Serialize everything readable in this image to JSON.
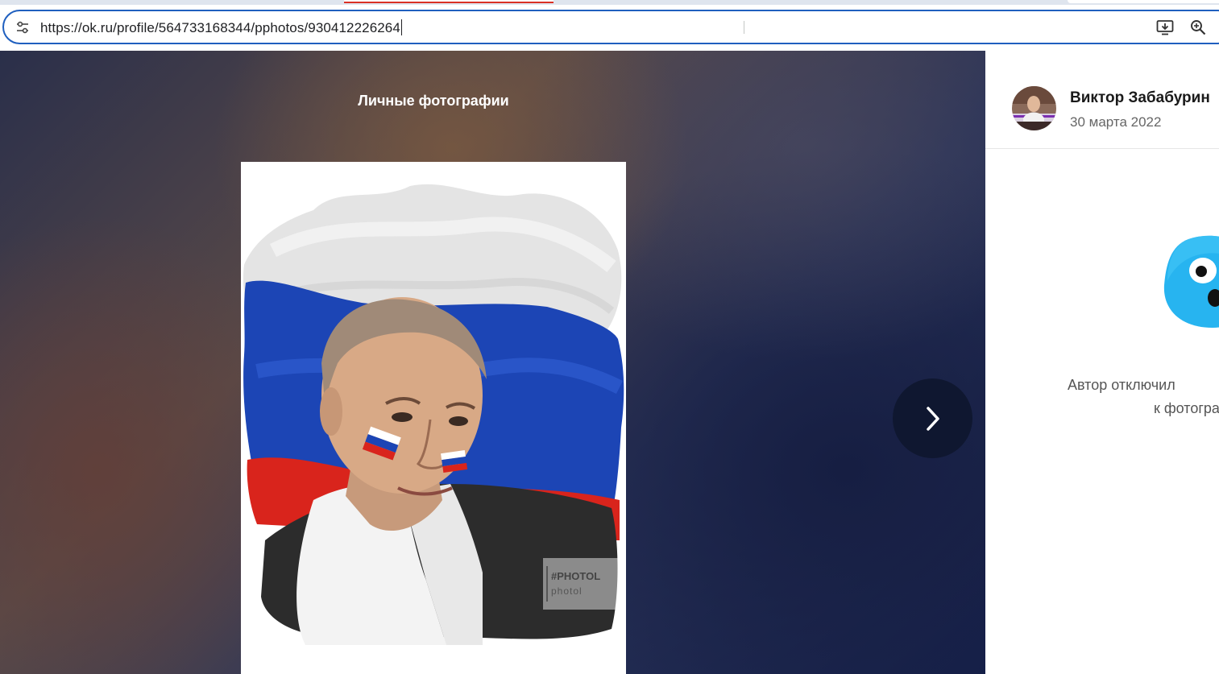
{
  "browser": {
    "url": "https://ok.ru/profile/564733168344/pphotos/930412226264",
    "icons": [
      "tune-icon",
      "install-app-icon",
      "zoom-icon"
    ]
  },
  "viewer": {
    "album_title": "Личные фотографии",
    "photo_watermark_line1": "#PHOTOL",
    "photo_watermark_line2": "photol",
    "next_icon": "chevron-right-icon"
  },
  "side": {
    "author_name": "Виктор Забабурин",
    "post_date": "30 марта 2022",
    "comments_disabled_line1": "Автор отключил",
    "comments_disabled_line2": "к фотогра"
  },
  "colors": {
    "omnibox_border": "#1f5fbf",
    "next_button": "#0f1730",
    "blob": "#27b4f0"
  }
}
